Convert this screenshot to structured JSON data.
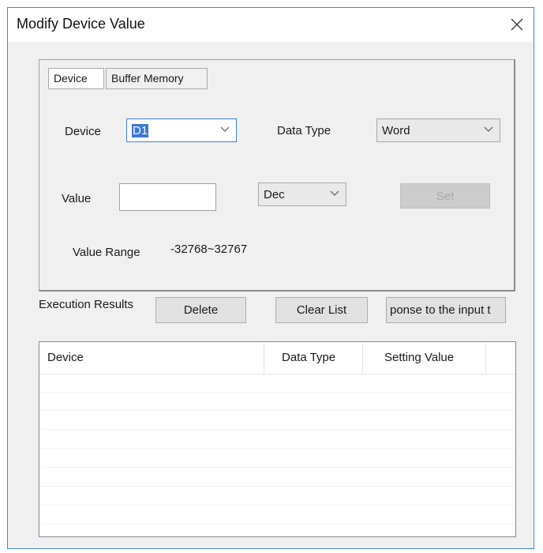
{
  "window": {
    "title": "Modify Device Value"
  },
  "tabs": [
    {
      "label": "Device",
      "active": true
    },
    {
      "label": "Buffer Memory",
      "active": false
    }
  ],
  "form": {
    "device_label": "Device",
    "device_value": "D1",
    "data_type_label": "Data Type",
    "data_type_value": "Word",
    "value_label": "Value",
    "value_input": "",
    "format_value": "Dec",
    "set_button": "Set",
    "value_range_label": "Value Range",
    "value_range": "-32768~32767"
  },
  "results": {
    "label": "Execution Results",
    "delete_button": "Delete",
    "clear_button": "Clear List",
    "response_button": "ponse to the input t"
  },
  "list": {
    "columns": [
      "Device",
      "Data Type",
      "Setting Value",
      ""
    ],
    "rows": []
  },
  "colors": {
    "accent": "#3c7fd1",
    "selection": "#3a78d4",
    "window_bg": "#f0f0f0"
  }
}
